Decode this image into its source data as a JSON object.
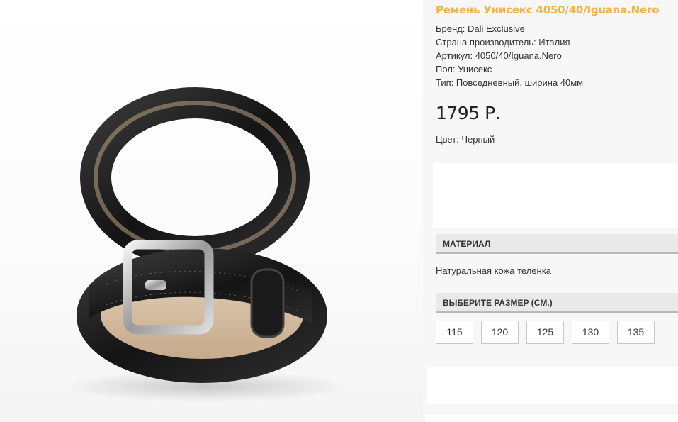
{
  "product": {
    "title": "Ремень Унисекс 4050/40/Iguana.Nero",
    "specs": [
      "Бренд: Dali Exclusive",
      "Страна производитель: Италия",
      "Артикул: 4050/40/Iguana.Nero",
      "Пол: Унисекс",
      "Тип: Повседневный, ширина 40мм"
    ],
    "price": "1795 Р.",
    "color": "Цвет: Черный"
  },
  "material": {
    "heading": "МАТЕРИАЛ",
    "text": "Натуральная кожа теленка"
  },
  "size": {
    "heading": "ВЫБЕРИТЕ РАЗМЕР (СМ.)",
    "options": [
      "115",
      "120",
      "125",
      "130",
      "135"
    ]
  },
  "colors": {
    "title": "#f0b24c",
    "panel": "#f7f7f7",
    "section_bg": "#e9e9e9"
  }
}
